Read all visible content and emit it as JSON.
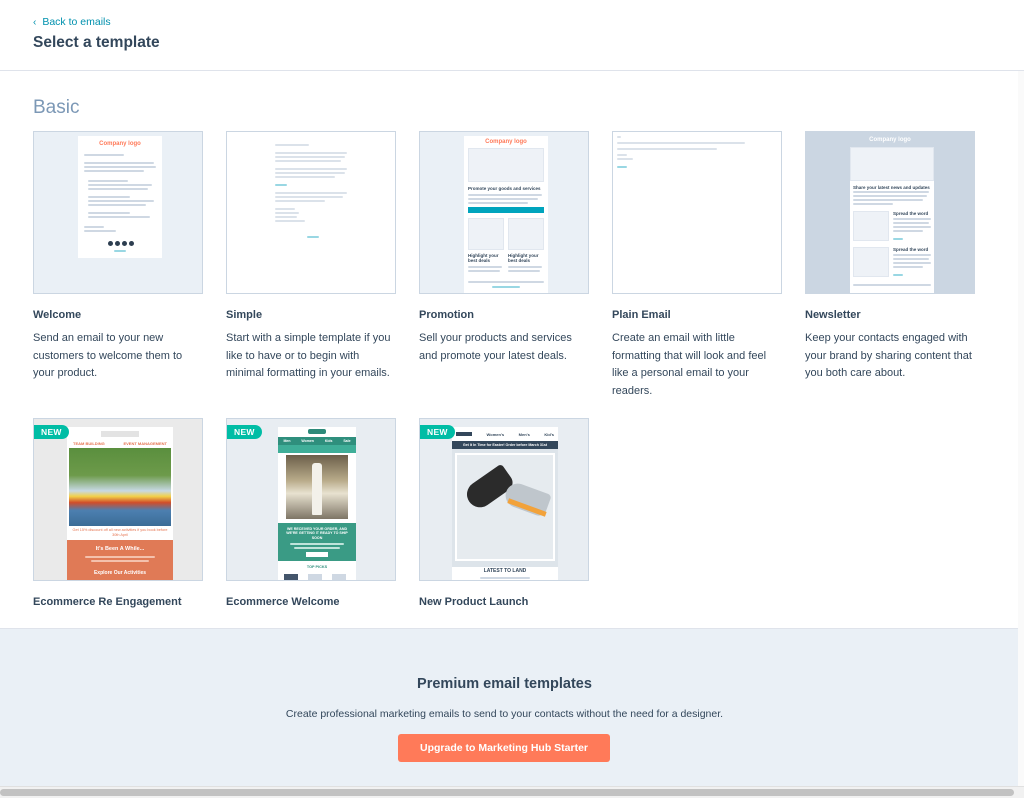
{
  "header": {
    "back_label": "Back to emails",
    "title": "Select a template"
  },
  "section": {
    "title": "Basic"
  },
  "templates": [
    {
      "name": "Welcome",
      "description": "Send an email to your new customers to welcome them to your product.",
      "new": false
    },
    {
      "name": "Simple",
      "description": "Start with a simple template if you like to have or to begin with minimal formatting in your emails.",
      "new": false
    },
    {
      "name": "Promotion",
      "description": "Sell your products and services and promote your latest deals.",
      "new": false
    },
    {
      "name": "Plain Email",
      "description": "Create an email with little formatting that will look and feel like a personal email to your readers.",
      "new": false
    },
    {
      "name": "Newsletter",
      "description": "Keep your contacts engaged with your brand by sharing content that you both care about.",
      "new": false
    },
    {
      "name": "Ecommerce Re Engagement",
      "description": "",
      "new": true
    },
    {
      "name": "Ecommerce Welcome",
      "description": "",
      "new": true
    },
    {
      "name": "New Product Launch",
      "description": "",
      "new": true
    }
  ],
  "badge_label": "NEW",
  "previews": {
    "company_logo": "Company logo",
    "promo_heading": "Promote your goods and services",
    "promo_highlight": "Highlight your best deals",
    "newsletter_heading": "Share your latest news and updates",
    "newsletter_spread": "Spread the word",
    "reengage_left": "TEAM BUILDING",
    "reengage_right": "EVENT MANAGEMENT",
    "reengage_offer": "Get 15% discount off all new activities if you book before 30th April",
    "reengage_heading": "It's Been A While...",
    "reengage_cta": "Explore Our Activities",
    "welcome_nav": [
      "Men",
      "Women",
      "Kids",
      "Sale"
    ],
    "welcome_tagline": "WE RECEIVED YOUR ORDER, AND WE'RE GETTING IT READY TO SHIP SOON",
    "welcome_top": "TOP PICKS",
    "launch_nav": [
      "Women's",
      "Men's",
      "Kid's"
    ],
    "launch_banner": "Get It In Time for Easter! Order before March 31st",
    "launch_caption": "LATEST TO LAND"
  },
  "premium": {
    "title": "Premium email templates",
    "description": "Create professional marketing emails to send to your contacts without the need for a designer.",
    "button_label": "Upgrade to Marketing Hub Starter"
  },
  "colors": {
    "accent": "#ff7a59",
    "link": "#0091ae",
    "badge": "#00bda5",
    "heading_muted": "#7c98b6"
  }
}
